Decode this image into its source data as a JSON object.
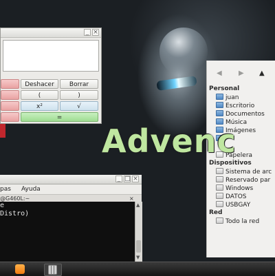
{
  "calculator": {
    "buttons": {
      "undo": "Deshacer",
      "clear": "Borrar",
      "open_paren": "(",
      "close_paren": ")",
      "square": "x²",
      "sqrt": "√",
      "equals": "="
    }
  },
  "overlay_text": "Advenc",
  "places": {
    "nav": {
      "back": "◀",
      "forward": "▶",
      "up": "▲"
    },
    "personal_header": "Personal",
    "personal_items": [
      "juan",
      "Escritorio",
      "Documentos",
      "Música",
      "Imágenes",
      "",
      "Papelera"
    ],
    "devices_header": "Dispositivos",
    "device_items": [
      "Sistema de arc",
      "Reservado par",
      "Windows",
      "DATOS",
      "USBGAY"
    ],
    "network_header": "Red",
    "network_items": [
      "Todo la red"
    ]
  },
  "terminal": {
    "menu": [
      "pas",
      "Ayuda"
    ],
    "tab_title": "@G460L:~",
    "lines": [
      "e",
      "Distro)"
    ]
  },
  "colors": {
    "calc_equals": "#9fdc92",
    "calc_clear_row": "#e9a2a2",
    "overlay": "#bfe7a0",
    "frame_red": "#c1272d"
  }
}
